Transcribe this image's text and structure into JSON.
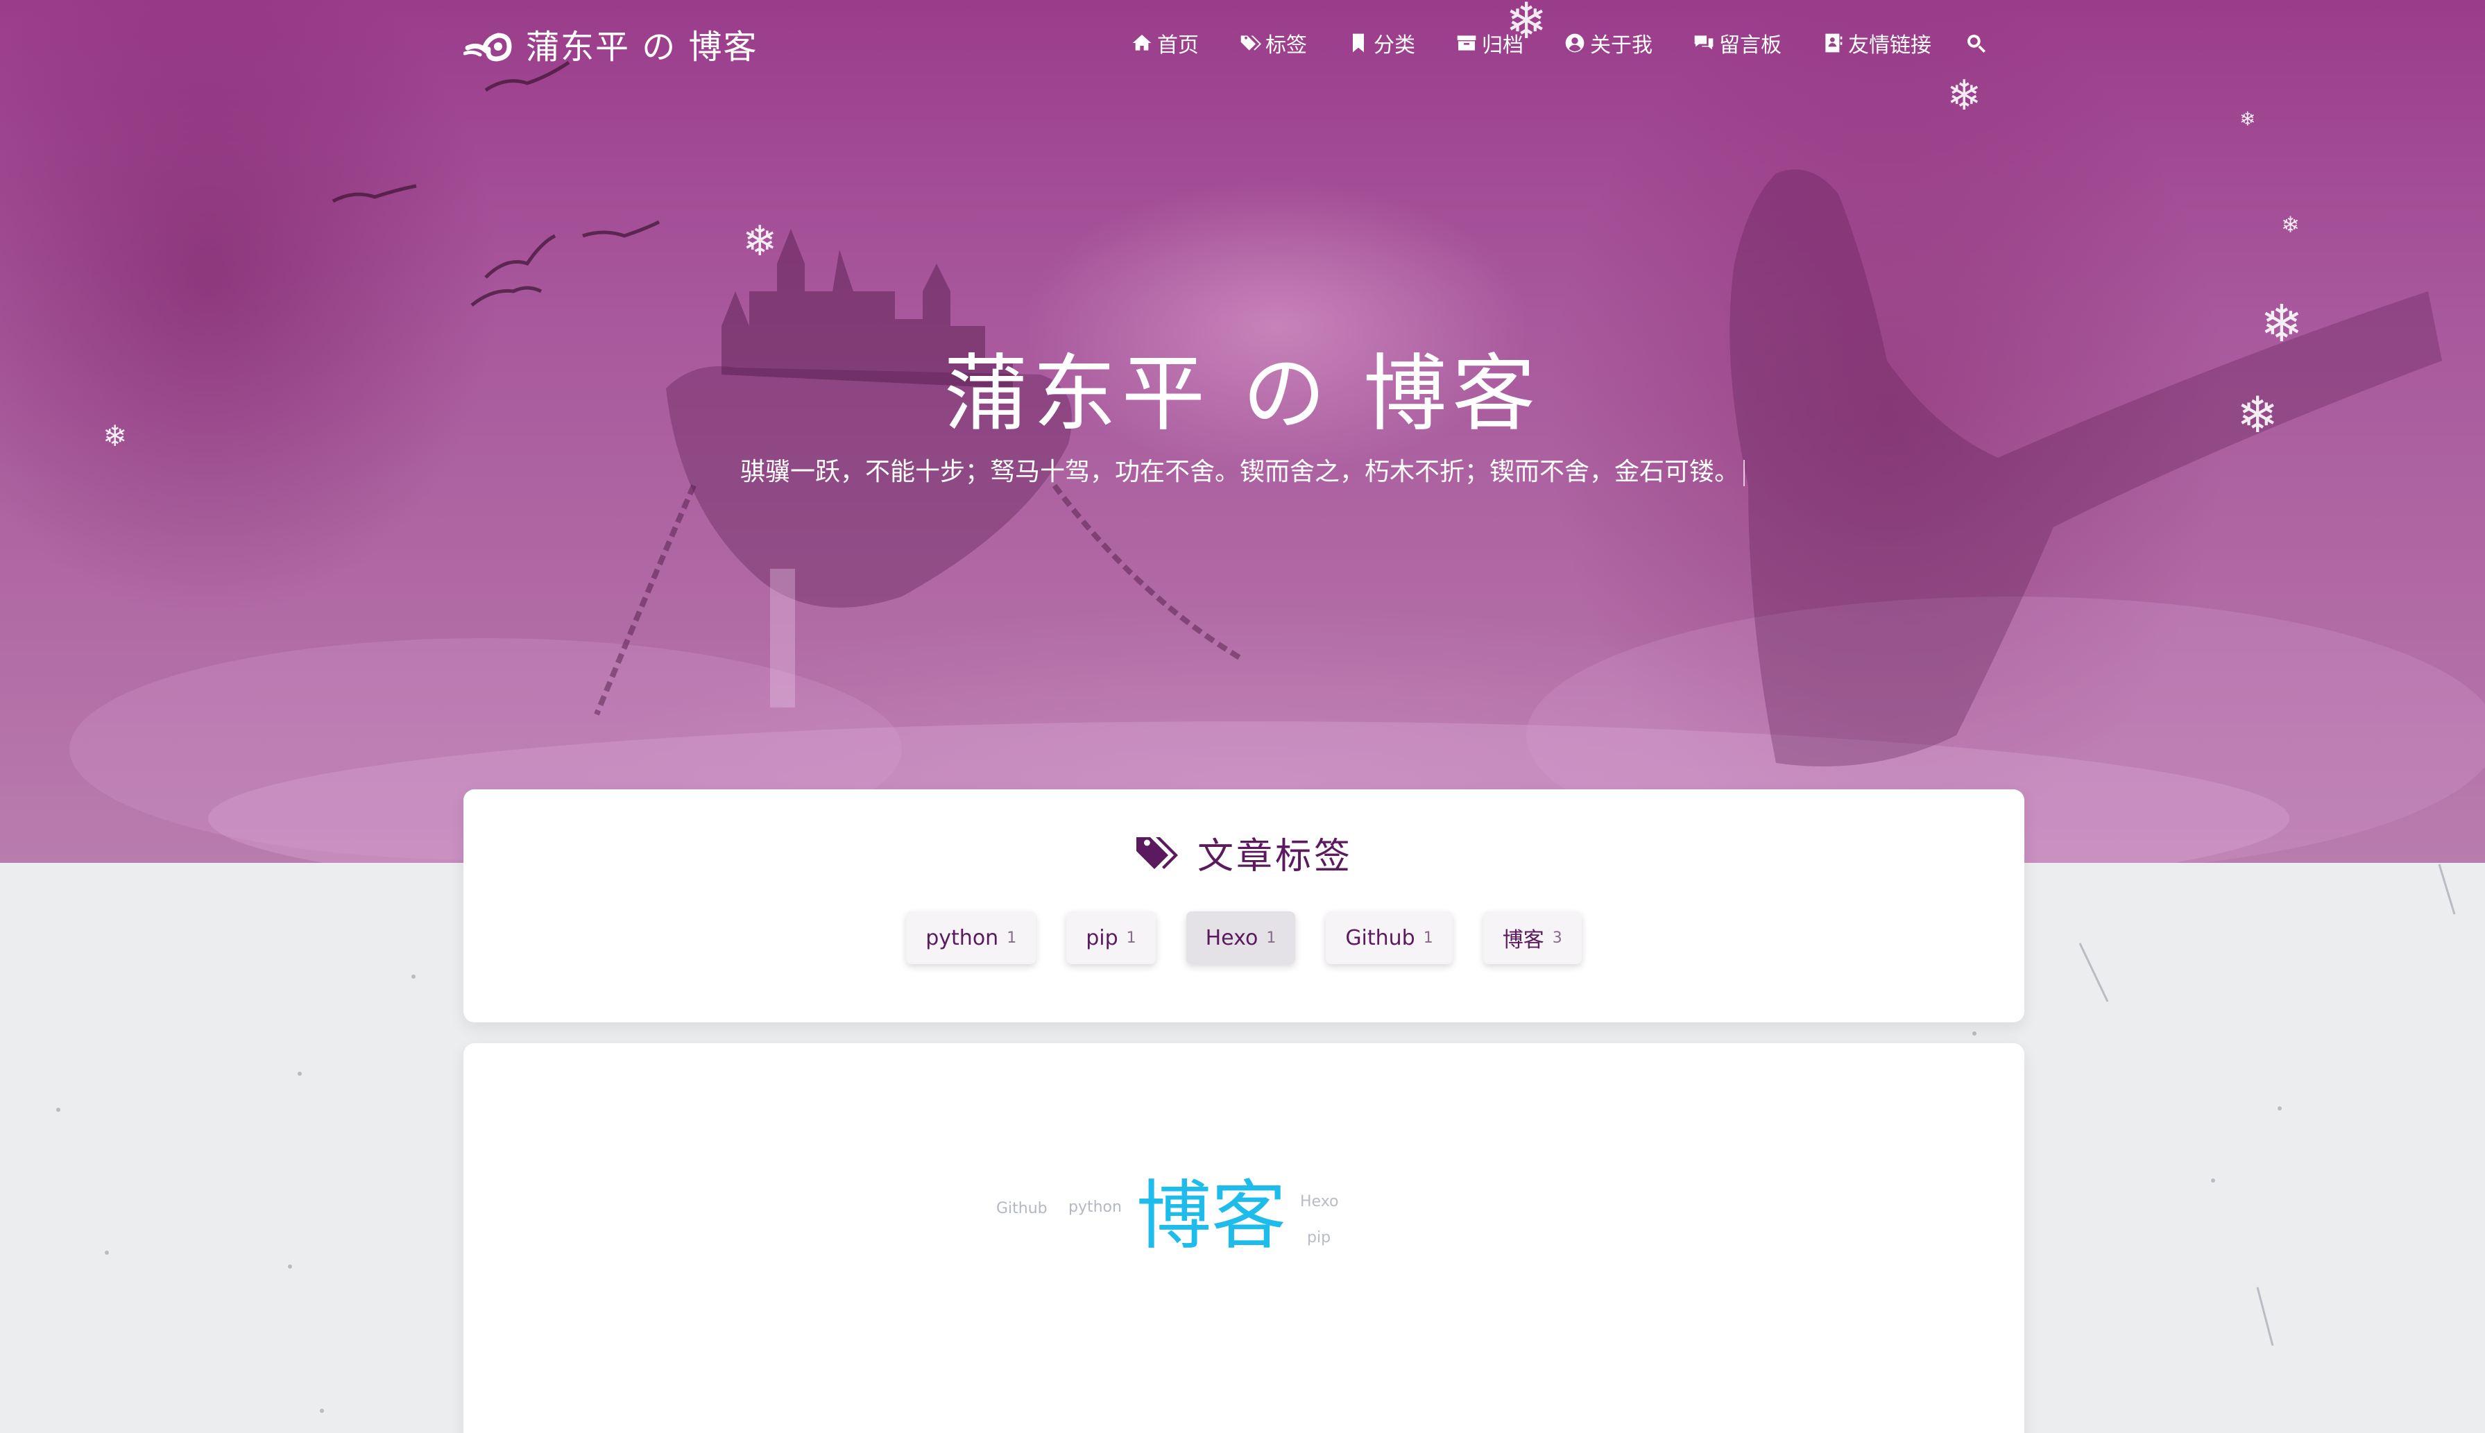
{
  "site": {
    "brand_title": "蒲东平 の 博客",
    "hero_title": "蒲东平 の 博客",
    "hero_subtitle": "骐骥一跃，不能十步；驽马十驾，功在不舍。锲而舍之，朽木不折；锲而不舍，金石可镂。"
  },
  "nav": {
    "items": [
      {
        "label": "首页",
        "icon": "home-icon"
      },
      {
        "label": "标签",
        "icon": "tags-icon"
      },
      {
        "label": "分类",
        "icon": "bookmark-icon"
      },
      {
        "label": "归档",
        "icon": "archive-icon"
      },
      {
        "label": "关于我",
        "icon": "user-circle-icon"
      },
      {
        "label": "留言板",
        "icon": "comments-icon"
      },
      {
        "label": "友情链接",
        "icon": "address-book-icon"
      }
    ],
    "search_icon": "search-icon"
  },
  "tags_panel": {
    "heading": "文章标签",
    "tags": [
      {
        "name": "python",
        "count": "1",
        "active": false
      },
      {
        "name": "pip",
        "count": "1",
        "active": false
      },
      {
        "name": "Hexo",
        "count": "1",
        "active": true
      },
      {
        "name": "Github",
        "count": "1",
        "active": false
      },
      {
        "name": "博客",
        "count": "3",
        "active": false
      }
    ]
  },
  "tag_cloud": {
    "words": [
      {
        "text": "Github",
        "color": "#b3b8c2"
      },
      {
        "text": "python",
        "color": "#b3b8c2"
      },
      {
        "text": "博客",
        "color": "#1ebcea"
      },
      {
        "text": "Hexo",
        "color": "#b8bcc4"
      },
      {
        "text": "pip",
        "color": "#b8bcc4"
      }
    ]
  },
  "colors": {
    "accent": "#5c1a5e",
    "hero_tint": "#a8579c",
    "cloud_highlight": "#1ebcea"
  }
}
